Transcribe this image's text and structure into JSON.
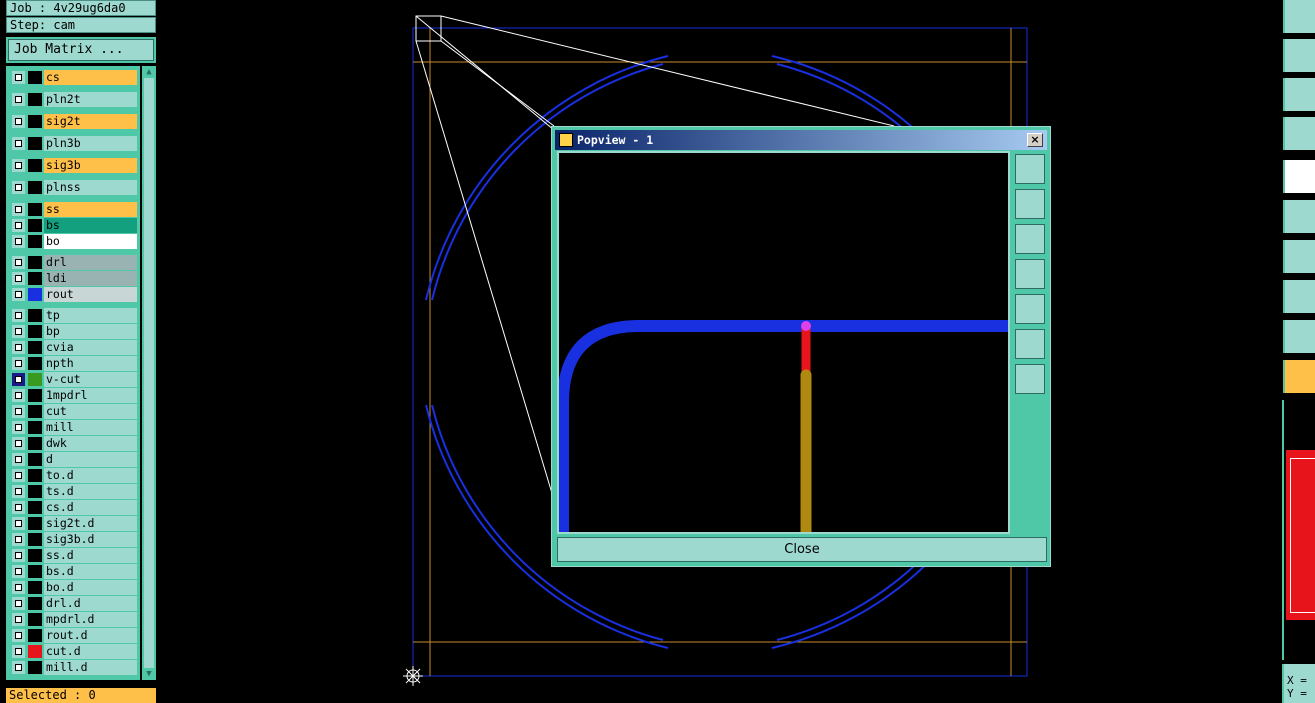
{
  "job": {
    "label": "Job : 4v29ug6da0"
  },
  "step": {
    "label": "Step: cam"
  },
  "job_matrix": {
    "label": "Job Matrix ..."
  },
  "layers": [
    {
      "name": "cs",
      "style": "sel-y",
      "swatch": "#000000"
    },
    {
      "name": "pln2t",
      "style": "",
      "swatch": "#000000"
    },
    {
      "name": "sig2t",
      "style": "sel-y",
      "swatch": "#000000"
    },
    {
      "name": "pln3b",
      "style": "",
      "swatch": "#000000"
    },
    {
      "name": "sig3b",
      "style": "sel-y",
      "swatch": "#000000"
    },
    {
      "name": "plnss",
      "style": "",
      "swatch": "#000000"
    },
    {
      "name": "ss",
      "style": "sel-y",
      "swatch": "#000000"
    },
    {
      "name": "bs",
      "style": "sel-g",
      "swatch": "#000000"
    },
    {
      "name": "bo",
      "style": "sel-w",
      "swatch": "#000000"
    },
    {
      "name": "drl",
      "style": "sel-gr",
      "swatch": "#000000"
    },
    {
      "name": "ldi",
      "style": "sel-gr",
      "swatch": "#000000"
    },
    {
      "name": "rout",
      "style": "sel-lg",
      "swatch": "#1830e0"
    },
    {
      "name": "tp",
      "style": "",
      "swatch": "#000000"
    },
    {
      "name": "bp",
      "style": "",
      "swatch": "#000000"
    },
    {
      "name": "cvia",
      "style": "",
      "swatch": "#000000"
    },
    {
      "name": "npth",
      "style": "",
      "swatch": "#000000"
    },
    {
      "name": "v-cut",
      "style": "",
      "swatch": "#3a9a20"
    },
    {
      "name": "1mpdrl",
      "style": "",
      "swatch": "#000000"
    },
    {
      "name": "cut",
      "style": "",
      "swatch": "#000000"
    },
    {
      "name": "mill",
      "style": "",
      "swatch": "#000000"
    },
    {
      "name": "dwk",
      "style": "",
      "swatch": "#000000"
    },
    {
      "name": "d",
      "style": "",
      "swatch": "#000000"
    },
    {
      "name": "to.d",
      "style": "",
      "swatch": "#000000"
    },
    {
      "name": "ts.d",
      "style": "",
      "swatch": "#000000"
    },
    {
      "name": "cs.d",
      "style": "",
      "swatch": "#000000"
    },
    {
      "name": "sig2t.d",
      "style": "",
      "swatch": "#000000"
    },
    {
      "name": "sig3b.d",
      "style": "",
      "swatch": "#000000"
    },
    {
      "name": "ss.d",
      "style": "",
      "swatch": "#000000"
    },
    {
      "name": "bs.d",
      "style": "",
      "swatch": "#000000"
    },
    {
      "name": "bo.d",
      "style": "",
      "swatch": "#000000"
    },
    {
      "name": "drl.d",
      "style": "",
      "swatch": "#000000"
    },
    {
      "name": "mpdrl.d",
      "style": "",
      "swatch": "#000000"
    },
    {
      "name": "rout.d",
      "style": "",
      "swatch": "#000000"
    },
    {
      "name": "cut.d",
      "style": "",
      "swatch": "#e8141c"
    },
    {
      "name": "mill.d",
      "style": "",
      "swatch": "#000000"
    }
  ],
  "selected": {
    "label": "Selected : 0"
  },
  "popview": {
    "title": "Popview - 1",
    "close_label": "Close",
    "close_x": "×"
  },
  "coords": {
    "x_label": "X =",
    "y_label": "Y ="
  },
  "colors": {
    "accent": "#4fc8a8",
    "panel": "#9ed9d0",
    "highlight": "#ffc04a",
    "rout": "#1830e0",
    "outline": "#ff9a20"
  }
}
